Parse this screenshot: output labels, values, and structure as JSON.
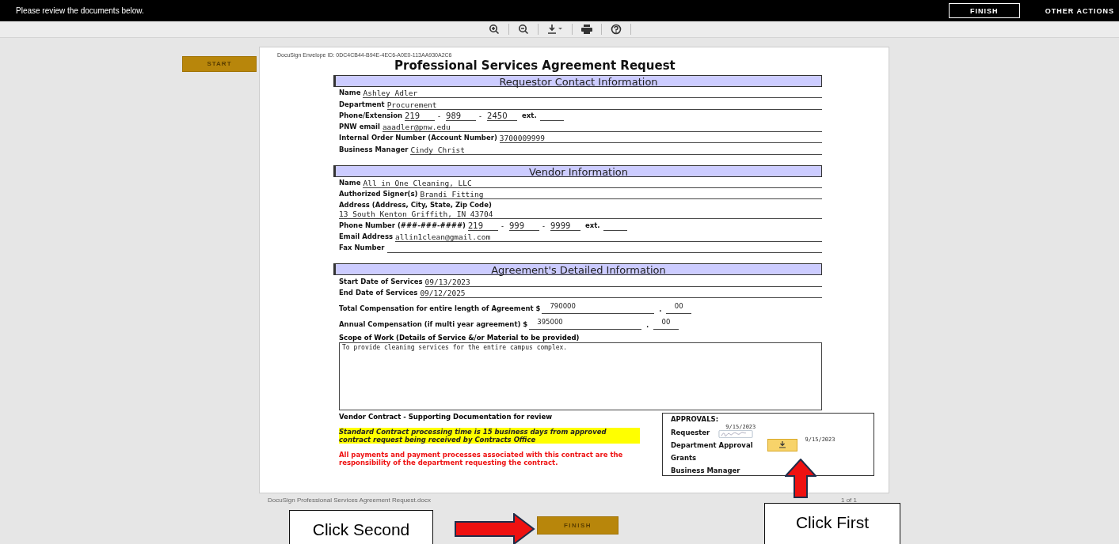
{
  "top_bar": {
    "message": "Please review the documents below.",
    "finish_button": "FINISH",
    "other_actions": "OTHER ACTIONS"
  },
  "start_button": "START",
  "document": {
    "envelope_id": "DocuSign Envelope ID: 0DC4CB44-B94E-4EC6-A0E0-113AA930A2C6",
    "title": "Professional Services Agreement Request",
    "sections": [
      {
        "title": "Requestor Contact Information",
        "fields": [
          {
            "kind": "text",
            "label": "Name",
            "value": "Ashley Adler"
          },
          {
            "kind": "text",
            "label": "Department",
            "value": "Procurement"
          },
          {
            "kind": "phone",
            "label": "Phone/Extension",
            "parts": [
              "219",
              "989",
              "2450"
            ],
            "separator": "-",
            "ext_label": "ext."
          },
          {
            "kind": "text",
            "label": "PNW email",
            "value": "aaadler@pnw.edu"
          },
          {
            "kind": "text",
            "label": "Internal Order Number (Account Number)",
            "value": "3700009999"
          },
          {
            "kind": "text",
            "label": "Business Manager",
            "value": "Cindy Christ"
          }
        ]
      },
      {
        "title": "Vendor Information",
        "fields": [
          {
            "kind": "text",
            "label": "Name",
            "value": "All in One Cleaning, LLC"
          },
          {
            "kind": "text",
            "label": "Authorized Signer(s)",
            "value": "Brandi Fitting"
          },
          {
            "kind": "address",
            "label": "Address (Address, City, State, Zip Code)",
            "value": "13 South Kenton Griffith, IN 43704"
          },
          {
            "kind": "phone",
            "label": "Phone Number (###-###-####)",
            "parts": [
              "219",
              "999",
              "9999"
            ],
            "separator": "-",
            "ext_label": "ext."
          },
          {
            "kind": "text",
            "label": "Email Address",
            "value": "allin1clean@gmail.com"
          },
          {
            "kind": "text",
            "label": "Fax Number"
          }
        ]
      },
      {
        "title": "Agreement's Detailed Information",
        "fields": [
          {
            "kind": "text",
            "label": "Start Date of Services",
            "value": "09/13/2023"
          },
          {
            "kind": "text",
            "label": "End Date of Services",
            "value": "09/12/2025"
          },
          {
            "kind": "money",
            "label": "Total Compensation for entire length of Agreement $",
            "dollars": "790000",
            "decimal": ".",
            "cents": "00"
          },
          {
            "kind": "money",
            "label": "Annual Compensation (if multi year agreement) $",
            "dollars": "395000",
            "decimal": ".",
            "cents": "00"
          }
        ]
      }
    ],
    "scope_label": "Scope of Work (Details of Service &/or Material to be provided)",
    "scope_value": "To provide cleaning services for the entire campus complex.",
    "supporting_docs": "Vendor Contract - Supporting Documentation for review",
    "processing_note": "Standard Contract processing time is 15 business days from approved contract request being received by Contracts Office",
    "payment_note": "All payments and payment processes associated with this contract are the responsibility of the department requesting the contract.",
    "approvals": {
      "title": "APPROVALS:",
      "rows": [
        {
          "kind": "signed",
          "label": "Requester",
          "date": "9/15/2023"
        },
        {
          "kind": "sign_here",
          "label": "Department Approval",
          "date": "9/15/2023"
        },
        {
          "kind": "plain",
          "label": "Grants"
        },
        {
          "kind": "plain",
          "label": "Business Manager"
        }
      ]
    }
  },
  "footer": {
    "filename": "DocuSign Professional Services Agreement Request.docx",
    "page_count": "1 of 1"
  },
  "bottom_finish_button": "FINISH",
  "annotations": {
    "second": "Click Second",
    "first": "Click First"
  }
}
